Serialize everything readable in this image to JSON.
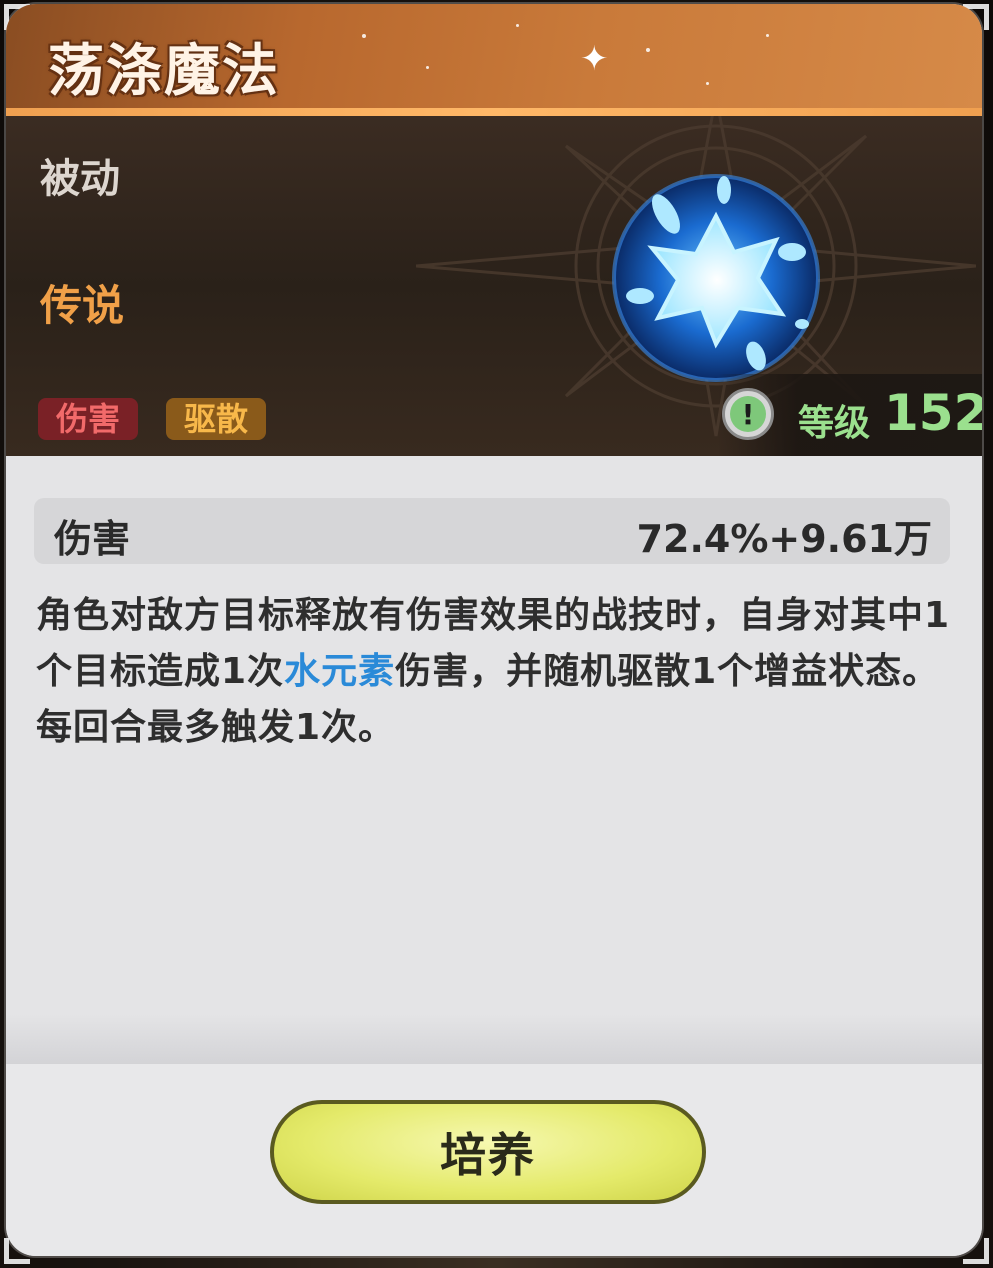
{
  "skill": {
    "name": "荡涤魔法",
    "type": "被动",
    "rarity": "传说",
    "tags": [
      "伤害",
      "驱散"
    ],
    "level_label": "等级",
    "level_value": "152"
  },
  "stat": {
    "name": "伤害",
    "value": "72.4%+9.61万"
  },
  "description": {
    "part1": "角色对敌方目标释放有伤害效果的战技时，自身对其中1个目标造成1次",
    "highlight": "水元素",
    "part2": "伤害，并随机驱散1个增益状态。每回合最多触发1次。"
  },
  "actions": {
    "cultivate_label": "培养"
  },
  "colors": {
    "rarity": "#f0a048",
    "highlight": "#2a8ad8",
    "level": "#9be08e",
    "tag_damage": "#f26a6a",
    "tag_dispel": "#f8b84a",
    "button": "#e4ea6a"
  },
  "icons": {
    "skill_icon": "water-burst-icon",
    "info_icon": "exclamation-icon"
  }
}
